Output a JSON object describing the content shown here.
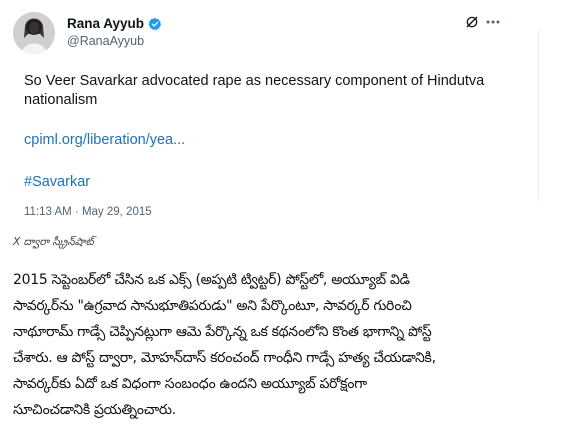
{
  "tweet": {
    "display_name": "Rana Ayyub",
    "handle": "@RanaAyyub",
    "text_line1": "So Veer Savarkar advocated rape as necessary component of Hindutva",
    "text_line2": "nationalism",
    "link": "cpiml.org/liberation/yea...",
    "hashtag": "#Savarkar",
    "timestamp": "11:13 AM · May 29, 2015",
    "link_color": "#1d72b8"
  },
  "caption": "X ద్వారా స్క్రీన్‌షాట్",
  "article": {
    "lines": [
      "2015 సెప్టెంబర్‌లో చేసిన ఒక ఎక్స్ (అప్పటి ట్విట్టర్) పోస్ట్‌లో, అయ్యూబ్ విడి",
      "సావర్కర్‌ను \"ఉగ్రవాద సానుభూతిపరుడు\" అని పేర్కొంటూ, సావర్కర్ గురించి",
      "నాథూరామ్ గాడ్సే చెప్పినట్లుగా ఆమె పేర్కొన్న ఒక కథనంలోని కొంత భాగాన్ని పోస్ట్",
      "చేశారు. ఆ పోస్ట్ ద్వారా, మోహన్‌దాస్ కరంచంద్ గాంధీని గాడ్సే హత్య చేయడానికి,",
      "సావర్కర్‌కు ఏదో ఒక విధంగా సంబంధం ఉందని అయ్యూబ్ పరోక్షంగా",
      "సూచించడానికి ప్రయత్నించారు."
    ]
  }
}
